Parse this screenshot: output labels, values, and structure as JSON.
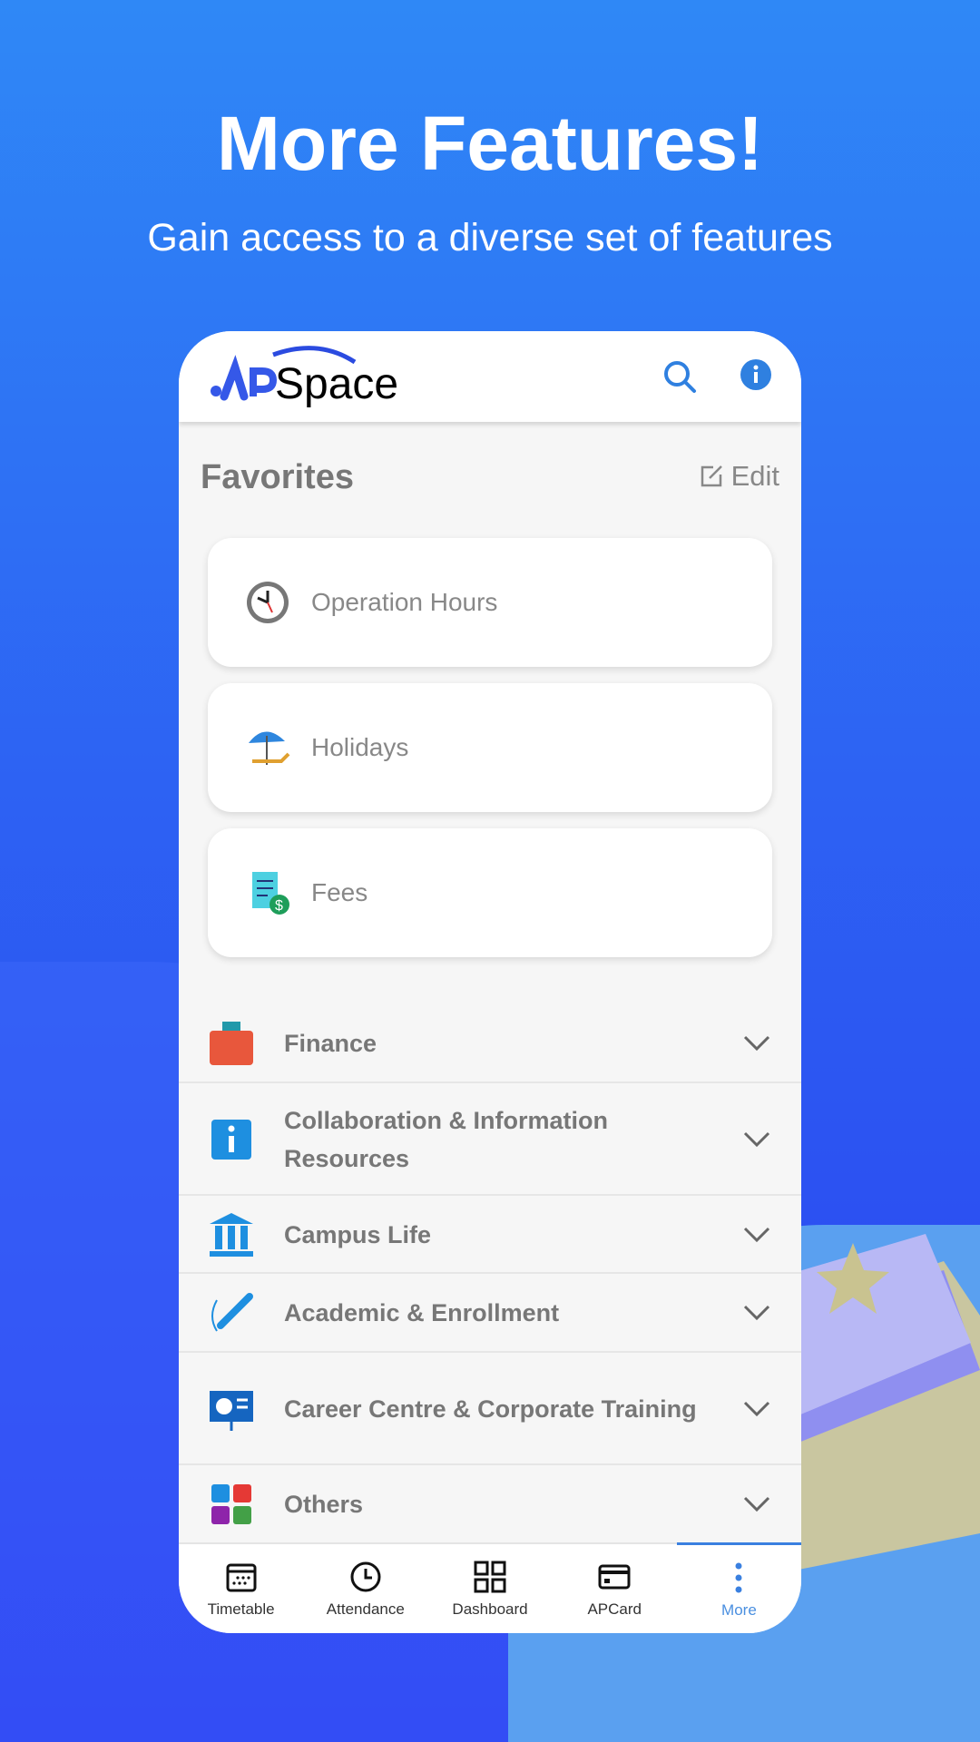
{
  "promo": {
    "title": "More Features!",
    "subtitle": "Gain access to a diverse set of features"
  },
  "app": {
    "logo": "APSpace",
    "header_icons": [
      "search-icon",
      "info-icon"
    ]
  },
  "favorites": {
    "heading": "Favorites",
    "edit_label": "Edit",
    "items": [
      {
        "label": "Operation Hours",
        "icon": "clock-icon"
      },
      {
        "label": "Holidays",
        "icon": "beach-umbrella-icon"
      },
      {
        "label": "Fees",
        "icon": "receipt-icon"
      }
    ]
  },
  "categories": [
    {
      "label": "Finance",
      "icon": "wallet-icon"
    },
    {
      "label": "Collaboration & Information Resources",
      "icon": "info-icon"
    },
    {
      "label": "Campus Life",
      "icon": "building-icon"
    },
    {
      "label": "Academic & Enrollment",
      "icon": "pen-icon"
    },
    {
      "label": "Career Centre & Corporate Training",
      "icon": "presentation-icon"
    },
    {
      "label": "Others",
      "icon": "shapes-icon"
    }
  ],
  "nav": {
    "items": [
      {
        "label": "Timetable",
        "icon": "calendar-icon"
      },
      {
        "label": "Attendance",
        "icon": "clock-icon"
      },
      {
        "label": "Dashboard",
        "icon": "grid-icon"
      },
      {
        "label": "APCard",
        "icon": "card-icon"
      },
      {
        "label": "More",
        "icon": "more-vertical-icon"
      }
    ],
    "active": "More"
  },
  "colors": {
    "accent": "#3a80e0",
    "background_top": "#2f88f6",
    "background_bottom": "#2a3cf0"
  }
}
